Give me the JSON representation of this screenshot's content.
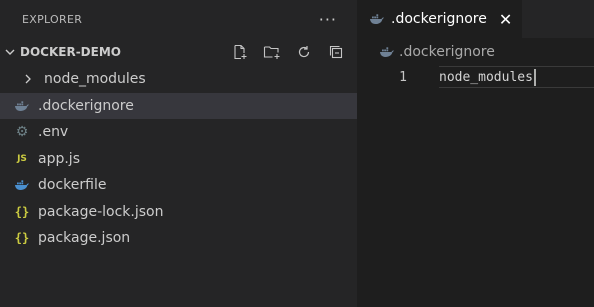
{
  "sidebar": {
    "title": "EXPLORER",
    "more_icon": "more-actions-icon",
    "project": {
      "name": "DOCKER-DEMO",
      "actions": [
        "new-file-icon",
        "new-folder-icon",
        "refresh-icon",
        "collapse-all-icon"
      ]
    },
    "items": [
      {
        "label": "node_modules",
        "kind": "folder",
        "icon": "chevron-right-icon"
      },
      {
        "label": ".dockerignore",
        "kind": "file",
        "icon": "docker-icon",
        "selected": true
      },
      {
        "label": ".env",
        "kind": "file",
        "icon": "gear-icon"
      },
      {
        "label": "app.js",
        "kind": "file",
        "icon": "js-icon",
        "icon_text": "JS"
      },
      {
        "label": "dockerfile",
        "kind": "file",
        "icon": "docker-icon"
      },
      {
        "label": "package-lock.json",
        "kind": "file",
        "icon": "json-icon",
        "icon_text": "{}"
      },
      {
        "label": "package.json",
        "kind": "file",
        "icon": "json-icon",
        "icon_text": "{}"
      }
    ]
  },
  "editor": {
    "tab": {
      "label": ".dockerignore",
      "icon": "docker-icon",
      "close": "close-icon"
    },
    "breadcrumb": {
      "label": ".dockerignore",
      "icon": "docker-icon"
    },
    "lines": [
      {
        "number": "1",
        "text": "node_modules"
      }
    ]
  },
  "colors": {
    "sidebar_bg": "#252526",
    "editor_bg": "#1e1e1e",
    "selected_row": "#37373d",
    "docker_icon": "#5a7ea8",
    "js_icon": "#cbcb41"
  }
}
